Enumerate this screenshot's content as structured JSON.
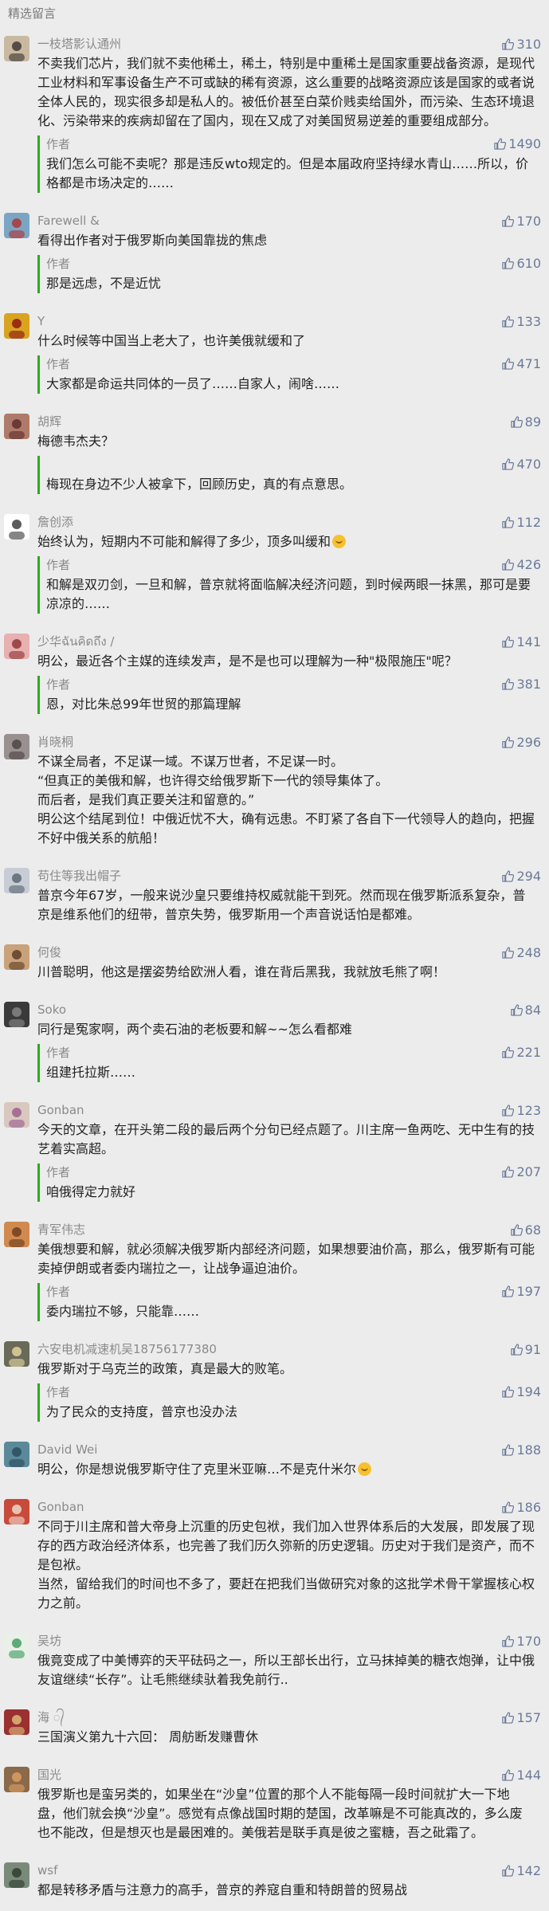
{
  "section_title": "精选留言",
  "icons": {
    "like": "thumbs-up-icon",
    "emoji": "smile-emoji-icon"
  },
  "colors": {
    "background": "#ececec",
    "author_bar": "#2aad19",
    "like_text": "#6b7a99"
  },
  "comments": [
    {
      "nick": "一枝塔影认通州",
      "likes": "310",
      "text": "不卖我们芯片，我们就不卖他稀土，稀土，特别是中重稀土是国家重要战备资源，是现代工业材料和军事设备生产不可或缺的稀有资源，这么重要的战略资源应该是国家的或者说全体人民的，现实很多却是私人的。被低价甚至白菜价贱卖给国外，而污染、生态环境退化、污染带来的疾病却留在了国内，现在又成了对美国贸易逆差的重要组成部分。",
      "reply": {
        "author": "作者",
        "likes": "1490",
        "text": "我们怎么可能不卖呢？那是违反wto规定的。但是本届政府坚持绿水青山……所以，价格都是市场决定的……"
      }
    },
    {
      "nick": "Farewell &",
      "likes": "170",
      "text": "看得出作者对于俄罗斯向美国靠拢的焦虑",
      "reply": {
        "author": "作者",
        "likes": "610",
        "text": "那是远虑，不是近忧"
      }
    },
    {
      "nick": "Y",
      "likes": "133",
      "text": "什么时候等中国当上老大了，也许美俄就缓和了",
      "reply": {
        "author": "作者",
        "likes": "471",
        "text": "大家都是命运共同体的一员了……自家人，闹啥……"
      }
    },
    {
      "nick": "胡辉",
      "likes": "89",
      "text": "梅德韦杰夫？",
      "reply": {
        "author": "",
        "likes": "470",
        "text": "梅现在身边不少人被拿下，回顾历史，真的有点意思。"
      }
    },
    {
      "nick": "詹创添",
      "likes": "112",
      "text": "始终认为，短期内不可能和解得了多少，顶多叫缓和",
      "emoji": true,
      "reply": {
        "author": "作者",
        "likes": "426",
        "text": "和解是双刃剑，一旦和解，普京就将面临解决经济问题，到时候两眼一抹黑，那可是要凉凉的……"
      }
    },
    {
      "nick": "少华ฉันคิดถึง /",
      "likes": "141",
      "text": "明公，最近各个主媒的连续发声，是不是也可以理解为一种\"极限施压\"呢？",
      "reply": {
        "author": "作者",
        "likes": "381",
        "text": "恩，对比朱总99年世贸的那篇理解"
      }
    },
    {
      "nick": "肖晓桐",
      "likes": "296",
      "text": "不谋全局者，不足谋一域。不谋万世者，不足谋一时。\n“但真正的美俄和解，也许得交给俄罗斯下一代的领导集体了。\n而后者，是我们真正要关注和留意的。”\n明公这个结尾到位！中俄近忧不大，确有远患。不盯紧了各自下一代领导人的趋向，把握不好中俄关系的航船！",
      "reply": null
    },
    {
      "nick": "苟住等我出帽子",
      "likes": "294",
      "text": "普京今年67岁，一般来说沙皇只要维持权威就能干到死。然而现在俄罗斯派系复杂，普京是维系他们的纽带，普京失势，俄罗斯用一个声音说话怕是都难。",
      "reply": null
    },
    {
      "nick": "何俊",
      "likes": "248",
      "text": "川普聪明，他这是摆姿势给欧洲人看，谁在背后黑我，我就放毛熊了啊！",
      "reply": null
    },
    {
      "nick": "Soko",
      "likes": "84",
      "text": "同行是冤家啊，两个卖石油的老板要和解~~怎么看都难",
      "reply": {
        "author": "作者",
        "likes": "221",
        "text": "组建托拉斯……"
      }
    },
    {
      "nick": "Gonban",
      "likes": "123",
      "text": "今天的文章，在开头第二段的最后两个分句已经点题了。川主席一鱼两吃、无中生有的技艺着实高超。",
      "reply": {
        "author": "作者",
        "likes": "207",
        "text": "咱俄得定力就好"
      }
    },
    {
      "nick": "青军伟志",
      "likes": "68",
      "text": "美俄想要和解，就必须解决俄罗斯内部经济问题，如果想要油价高，那么，俄罗斯有可能卖掉伊朗或者委内瑞拉之一，让战争逼迫油价。",
      "reply": {
        "author": "作者",
        "likes": "197",
        "text": "委内瑞拉不够，只能靠……"
      }
    },
    {
      "nick": "六安电机减速机吴18756177380",
      "likes": "91",
      "text": "俄罗斯对于乌克兰的政策，真是最大的败笔。",
      "reply": {
        "author": "作者",
        "likes": "194",
        "text": "为了民众的支持度，普京也没办法"
      }
    },
    {
      "nick": "David Wei",
      "likes": "188",
      "text": "明公，你是想说俄罗斯守住了克里米亚嘛…不是克什米尔",
      "emoji": true,
      "reply": null
    },
    {
      "nick": "Gonban",
      "likes": "186",
      "text": "不同于川主席和普大帝身上沉重的历史包袱，我们加入世界体系后的大发展，即发展了现存的西方政治经济体系，也完善了我们历久弥新的历史逻辑。历史对于我们是资产，而不是包袱。\n当然，留给我们的时间也不多了，要赶在把我们当做研究对象的这批学术骨干掌握核心权力之前。",
      "reply": null
    },
    {
      "nick": "吴坊",
      "likes": "170",
      "text": "俄竟变成了中美博弈的天平砝码之一，所以王部长出行，立马抹掉美的糖衣炮弹，让中俄友谊继续“长存”。让毛熊继续驮着我免前行..",
      "reply": null
    },
    {
      "nick": "海 ᭄",
      "likes": "157",
      "text": "三国演义第九十六回：  周舫断发赚曹休",
      "reply": null
    },
    {
      "nick": "国光",
      "likes": "144",
      "text": "俄罗斯也是蛮另类的，如果坐在“沙皇”位置的那个人不能每隔一段时间就扩大一下地盘，他们就会换“沙皇”。感觉有点像战国时期的楚国，改革嘛是不可能真改的，多么废也不能改，但是想灭也是最困难的。美俄若是联手真是彼之蜜糖，吾之砒霜了。",
      "reply": null
    },
    {
      "nick": "wsf",
      "likes": "142",
      "text": "都是转移矛盾与注意力的高手，普京的养寇自重和特朗普的贸易战",
      "reply": null
    }
  ]
}
